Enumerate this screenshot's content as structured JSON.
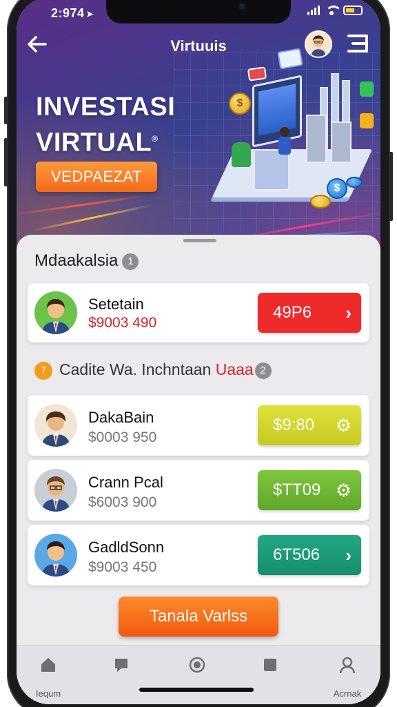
{
  "status": {
    "time": "2:974",
    "nav_arrow": "➤"
  },
  "nav": {
    "back_icon": "arrow-left-icon",
    "title": "Virtuuis",
    "menu_icon": "menu-icon"
  },
  "hero": {
    "title_line1": "INVESTASI",
    "title_line2": "VIRTUAL",
    "title_mark": "®",
    "cta_label": "VEDPAEZAT"
  },
  "section": {
    "title": "Mdaakalsia",
    "badge": "1"
  },
  "featured": {
    "name": "Setetain",
    "amount": "$9003 490",
    "action_label": "49P6",
    "action_icon": "chevron-right-icon",
    "action_glyph": "›",
    "color": "#ef2a2a"
  },
  "subsection": {
    "marker": "7",
    "title_main": "Cadite Wa. Inchntaan",
    "title_highlight": "Uaaa",
    "badge": "2"
  },
  "list": [
    {
      "name": "DakaBain",
      "amount": "$0003 950",
      "action_label": "$9:80",
      "action_icon": "gear-icon",
      "action_glyph": "⚙",
      "color": "#cfd42a"
    },
    {
      "name": "Crann Pcal",
      "amount": "$6003 900",
      "action_label": "$TT09",
      "action_icon": "gear-icon",
      "action_glyph": "⚙",
      "color": "#6fb832"
    },
    {
      "name": "GadldSonn",
      "amount": "$9003 450",
      "action_label": "6T506",
      "action_icon": "chevron-right-icon",
      "action_glyph": "›",
      "color": "#1c9f7a"
    }
  ],
  "bottom_cta": {
    "label": "Tanala Varlss"
  },
  "tabs": [
    {
      "icon": "home-icon",
      "label": "Iequm"
    },
    {
      "icon": "chat-icon",
      "label": ""
    },
    {
      "icon": "record-icon",
      "label": ""
    },
    {
      "icon": "square-icon",
      "label": ""
    },
    {
      "icon": "profile-icon",
      "label": "Acrnak"
    }
  ]
}
